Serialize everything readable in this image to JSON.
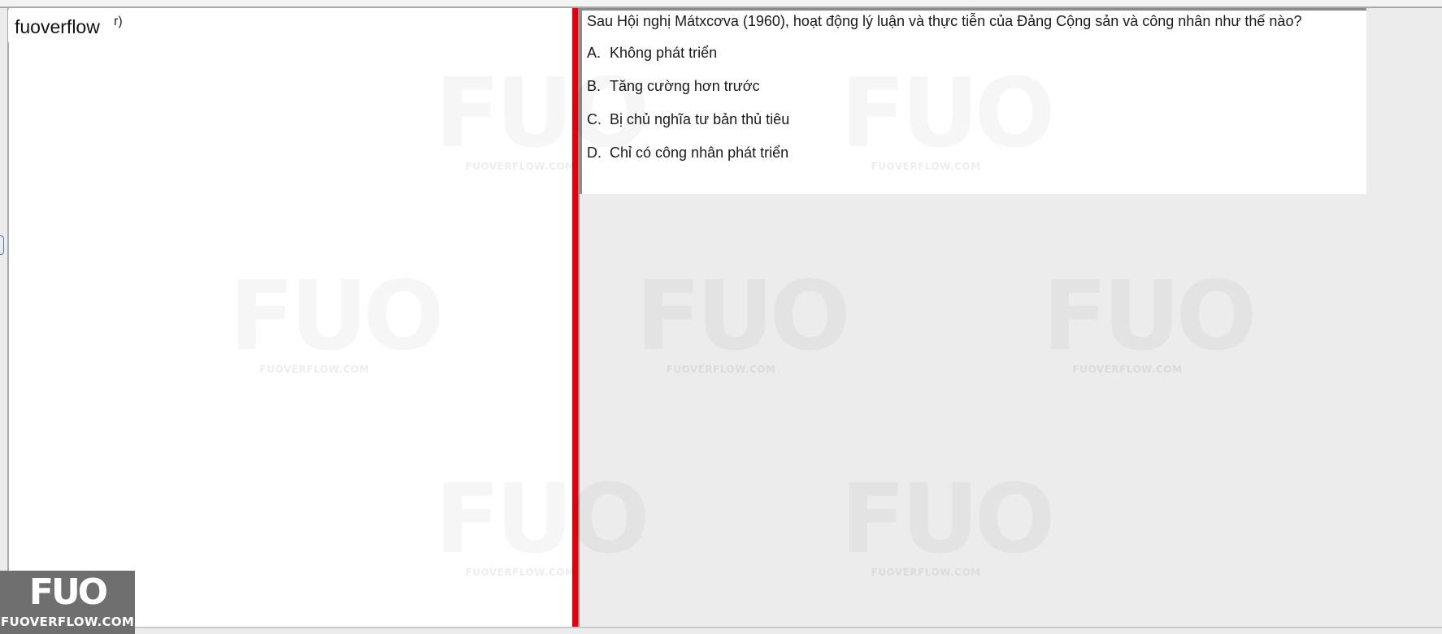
{
  "left_pane": {
    "brand": "fuoverflow",
    "paren_fragment": "r)"
  },
  "question": {
    "text": "Sau Hội nghị Mátxcơva (1960), hoạt động lý luận và thực tiễn của Đảng Cộng sản và công nhân như thế nào?",
    "options": [
      {
        "letter": "A.",
        "text": "Không phát triển"
      },
      {
        "letter": "B.",
        "text": "Tăng cường hơn trước"
      },
      {
        "letter": "C.",
        "text": "Bị chủ nghĩa tư bản thủ tiêu"
      },
      {
        "letter": "D.",
        "text": "Chỉ có công nhân phát triển"
      }
    ]
  },
  "watermark": {
    "logo": "FUO",
    "site": "FUOVERFLOW.COM"
  },
  "corner_logo": {
    "logo": "FUO",
    "site": "FUOVERFLOW.COM"
  },
  "colors": {
    "splitter": "#e3000f",
    "corner_logo_bg": "#6f6f6f",
    "right_pane_bg": "#ececec"
  }
}
